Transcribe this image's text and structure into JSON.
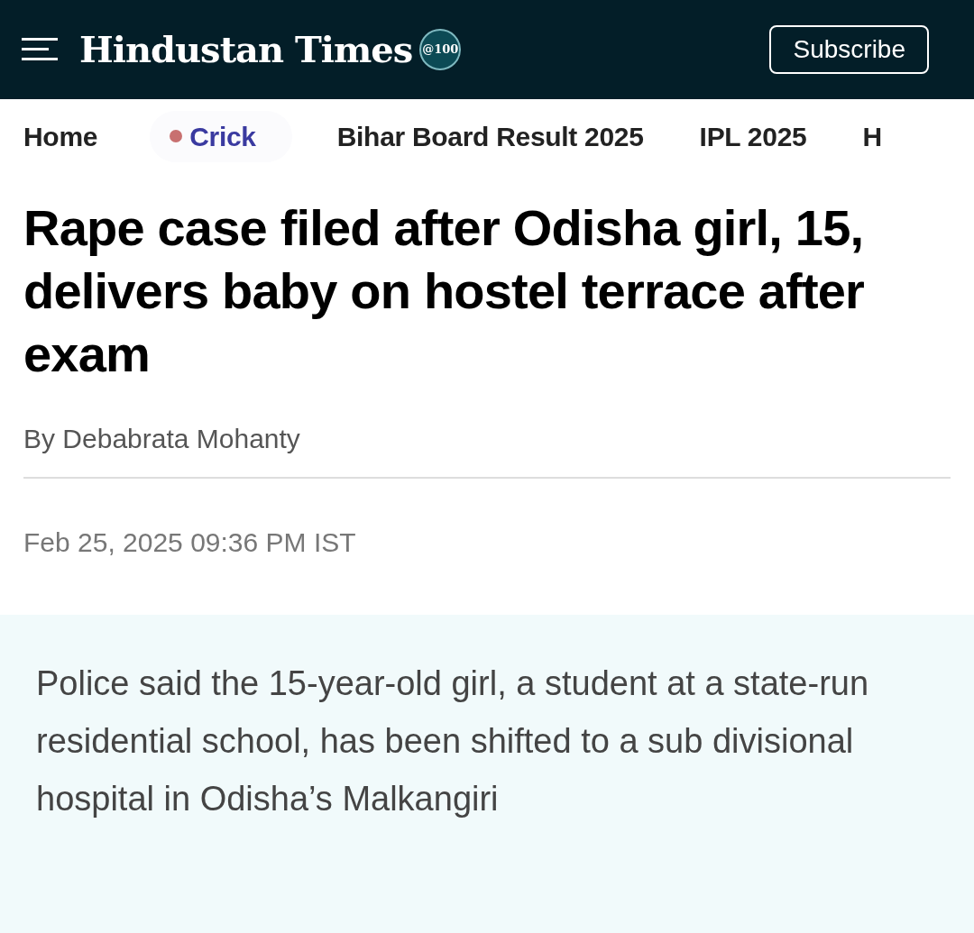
{
  "header": {
    "logo": "Hindustan Times",
    "badge": "@100",
    "subscribe_button": "Subscribe"
  },
  "nav": [
    {
      "label": "Home",
      "kind": "link"
    },
    {
      "label": "Crick",
      "kind": "featured"
    },
    {
      "label": "Bihar Board Result 2025",
      "kind": "link"
    },
    {
      "label": "IPL 2025",
      "kind": "link"
    },
    {
      "label": "H",
      "kind": "link"
    }
  ],
  "article": {
    "headline": "Rape case filed after Odisha girl, 15, delivers baby on hostel terrace after exam",
    "byline": "By Debabrata Mohanty",
    "date": "Feb 25, 2025 09:36 PM IST",
    "summary": "Police said the 15-year-old girl, a student at a state-run residential school, has been shifted to a sub divisional hospital in Odisha’s Malkangiri"
  }
}
